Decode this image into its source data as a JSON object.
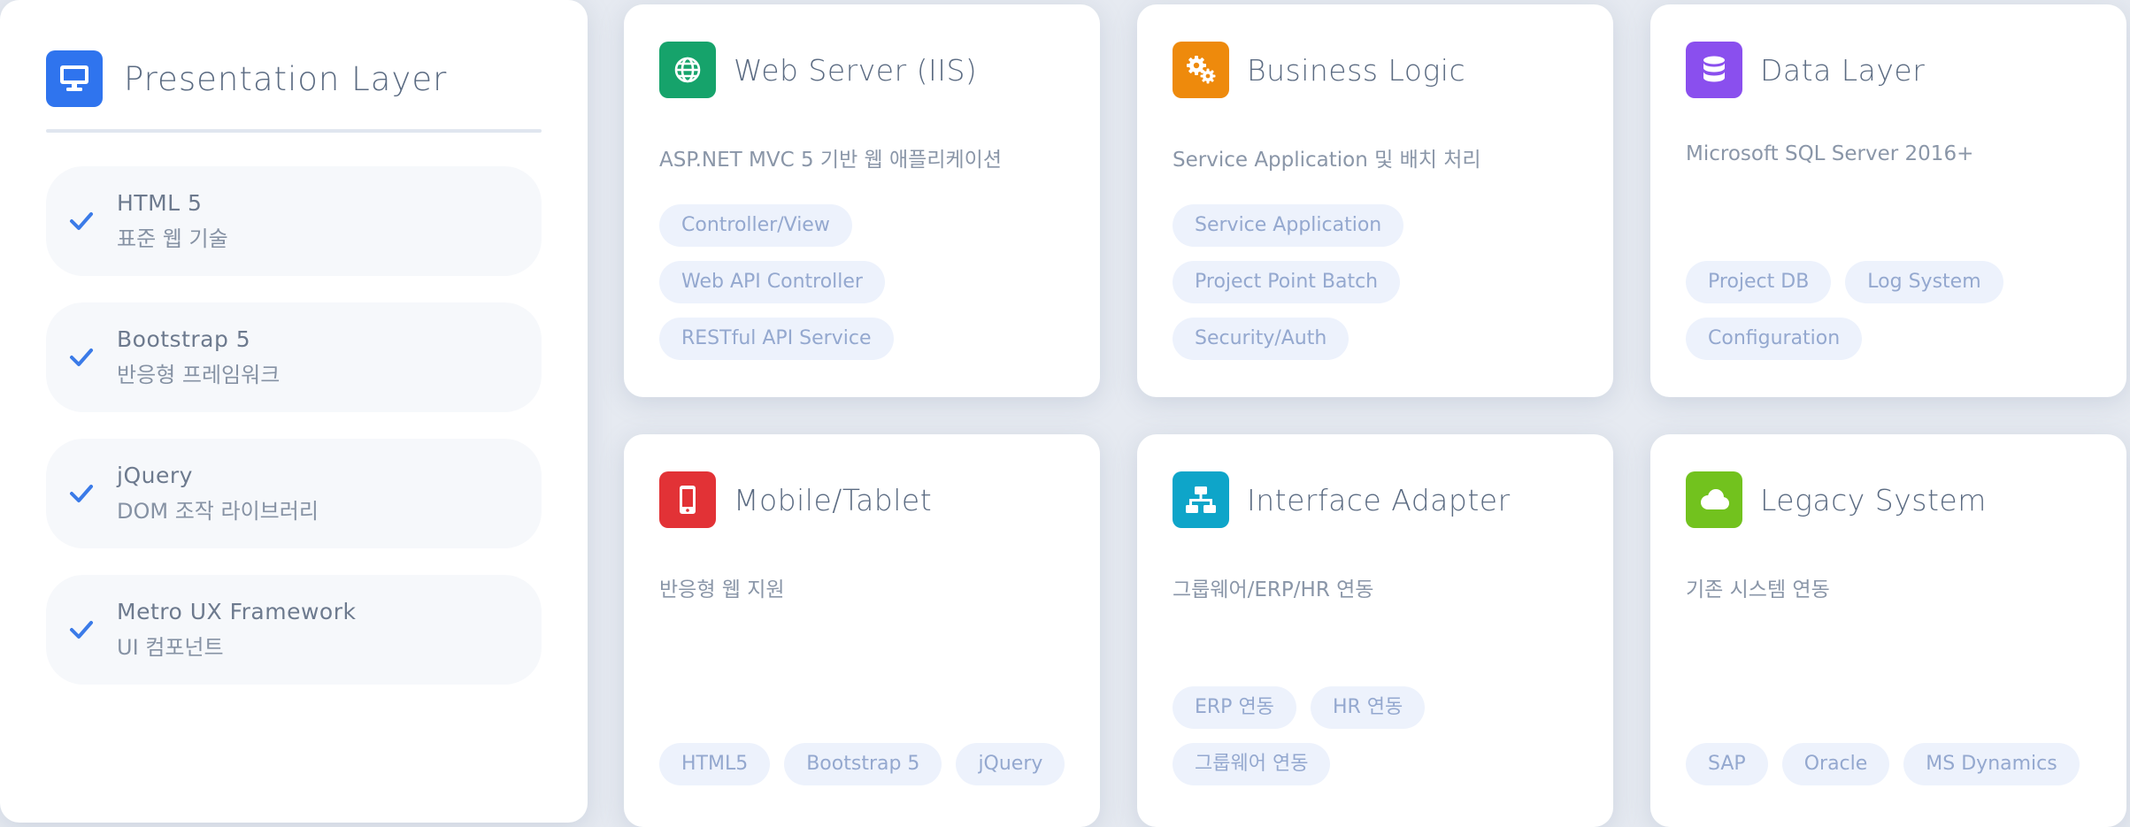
{
  "presentation": {
    "title": "Presentation Layer",
    "items": [
      {
        "name": "HTML 5",
        "desc": "표준 웹 기술"
      },
      {
        "name": "Bootstrap 5",
        "desc": "반응형 프레임워크"
      },
      {
        "name": "jQuery",
        "desc": "DOM 조작 라이브러리"
      },
      {
        "name": "Metro UX Framework",
        "desc": "UI 컴포넌트"
      }
    ]
  },
  "components": [
    {
      "title": "Web Server (IIS)",
      "desc": "ASP.NET MVC 5 기반 웹 애플리케이션",
      "icon": "globe-icon",
      "color": "#16a36b",
      "tags": [
        "Controller/View",
        "Web API Controller",
        "RESTful API Service"
      ]
    },
    {
      "title": "Business Logic",
      "desc": "Service Application 및 배치 처리",
      "icon": "gears-icon",
      "color": "#ee8a0c",
      "tags": [
        "Service Application",
        "Project Point Batch",
        "Security/Auth"
      ]
    },
    {
      "title": "Data Layer",
      "desc": "Microsoft SQL Server 2016+",
      "icon": "database-icon",
      "color": "#8a4fee",
      "tags": [
        "Project DB",
        "Log System",
        "Configuration"
      ]
    },
    {
      "title": "Mobile/Tablet",
      "desc": "반응형 웹 지원",
      "icon": "mobile-icon",
      "color": "#e23236",
      "tags": [
        "HTML5",
        "Bootstrap 5",
        "jQuery"
      ]
    },
    {
      "title": "Interface Adapter",
      "desc": "그룹웨어/ERP/HR 연동",
      "icon": "network-icon",
      "color": "#0ea5c9",
      "tags": [
        "ERP 연동",
        "HR 연동",
        "그룹웨어 연동"
      ]
    },
    {
      "title": "Legacy System",
      "desc": "기존 시스템 연동",
      "icon": "cloud-icon",
      "color": "#72c21e",
      "tags": [
        "SAP",
        "Oracle",
        "MS Dynamics"
      ]
    }
  ],
  "colors": {
    "presentation": "#2f74ee",
    "check": "#3b7be8",
    "tag_bg": "#edf2fc",
    "tag_text": "#94a8cf"
  }
}
